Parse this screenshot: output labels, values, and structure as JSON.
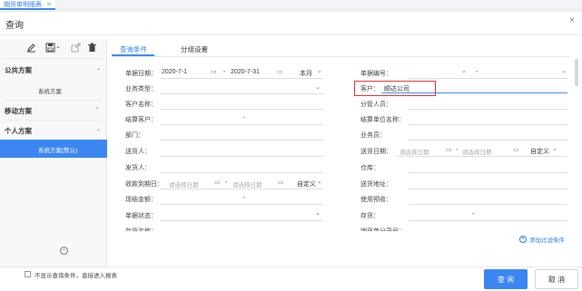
{
  "tab": {
    "title": "销货单明细表",
    "close": "✕"
  },
  "dialog": {
    "title": "查询",
    "close": "×"
  },
  "toolbar": {
    "edit_icon": "pencil-icon",
    "save_icon": "save-icon",
    "export_icon": "export-icon",
    "delete_icon": "trash-icon",
    "save_caret": "⌄"
  },
  "sidebar": {
    "sections": [
      {
        "header": "公共方案",
        "items": [
          "系统方案"
        ]
      },
      {
        "header": "移动方案",
        "items": []
      },
      {
        "header": "个人方案",
        "items": [
          "系统方案(默认)"
        ]
      }
    ],
    "pager_icon": "‹"
  },
  "content_tabs": [
    "查询条件",
    "分组设置"
  ],
  "left_fields": [
    {
      "label": "单据日期：",
      "from": "2020-7-1",
      "to": "2020-7-31",
      "sep": "-",
      "period": "本月"
    },
    {
      "label": "业务类型："
    },
    {
      "label": "客户名称："
    },
    {
      "label": "结算客户：",
      "sep": "-"
    },
    {
      "label": "部门："
    },
    {
      "label": "送货人："
    },
    {
      "label": "发货人："
    },
    {
      "label": "收款到期日：",
      "from_ph": "请选择日期",
      "to_ph": "请选择日期",
      "sep": "-",
      "period": "自定义"
    },
    {
      "label": "现结金额：",
      "sep": "-"
    },
    {
      "label": "单据状态："
    },
    {
      "label": "存货名称："
    }
  ],
  "right_fields": [
    {
      "label": "单据编号：",
      "sep": "-"
    },
    {
      "label": "客户：",
      "value": "顺达公司"
    },
    {
      "label": "分管人员："
    },
    {
      "label": "结算单位名称："
    },
    {
      "label": "业务员："
    },
    {
      "label": "送货日期：",
      "from_ph": "请选择日期",
      "to_ph": "请选择日期",
      "sep": "-",
      "period": "自定义"
    },
    {
      "label": "仓库："
    },
    {
      "label": "送货地址："
    },
    {
      "label": "使用预收："
    },
    {
      "label": "存货：",
      "sep": "-"
    },
    {
      "label": "销货单分录号："
    }
  ],
  "add_filter": "添加过滤条件",
  "footer": {
    "checkbox_label": "不显示查询条件，直接进入报表",
    "query": "查 询",
    "cancel": "取 消"
  }
}
